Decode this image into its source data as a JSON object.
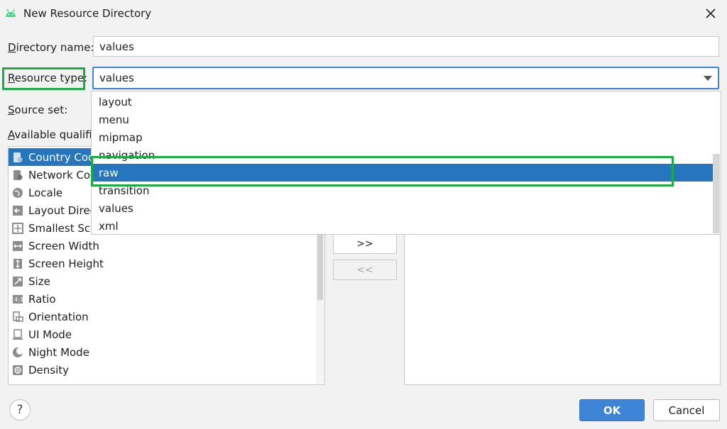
{
  "window": {
    "title": "New Resource Directory"
  },
  "form": {
    "directory_name_label": "irectory name:",
    "directory_name_mnemonic": "D",
    "directory_name_value": "values",
    "resource_type_label": "esource type:",
    "resource_type_mnemonic": "R",
    "resource_type_value": "values",
    "source_set_label": "ource set:",
    "source_set_mnemonic": "S",
    "available_qualifiers_label": "vailable qualifier",
    "available_qualifiers_mnemonic": "A"
  },
  "resource_type_dropdown": {
    "options": [
      "layout",
      "menu",
      "mipmap",
      "navigation",
      "raw",
      "transition",
      "values",
      "xml"
    ],
    "selected": "raw"
  },
  "qualifiers": {
    "items": [
      {
        "label": "Country Code",
        "icon": "country-code-icon"
      },
      {
        "label": "Network Code",
        "icon": "network-code-icon"
      },
      {
        "label": "Locale",
        "icon": "globe-icon"
      },
      {
        "label": "Layout Directi",
        "icon": "layout-direction-icon"
      },
      {
        "label": "Smallest Scree",
        "icon": "smallest-screen-icon"
      },
      {
        "label": "Screen Width",
        "icon": "screen-width-icon"
      },
      {
        "label": "Screen Height",
        "icon": "screen-height-icon"
      },
      {
        "label": "Size",
        "icon": "size-icon"
      },
      {
        "label": "Ratio",
        "icon": "ratio-icon"
      },
      {
        "label": "Orientation",
        "icon": "orientation-icon"
      },
      {
        "label": "UI Mode",
        "icon": "ui-mode-icon"
      },
      {
        "label": "Night Mode",
        "icon": "night-mode-icon"
      },
      {
        "label": "Density",
        "icon": "density-icon"
      }
    ],
    "selected": "Country Code"
  },
  "transfer": {
    "add_label": ">>",
    "remove_label": "<<"
  },
  "footer": {
    "help_label": "?",
    "ok_label": "OK",
    "cancel_label": "Cancel"
  },
  "colors": {
    "accent": "#3d83d6",
    "selection": "#2675bf",
    "highlight_outline": "#1aad43"
  }
}
